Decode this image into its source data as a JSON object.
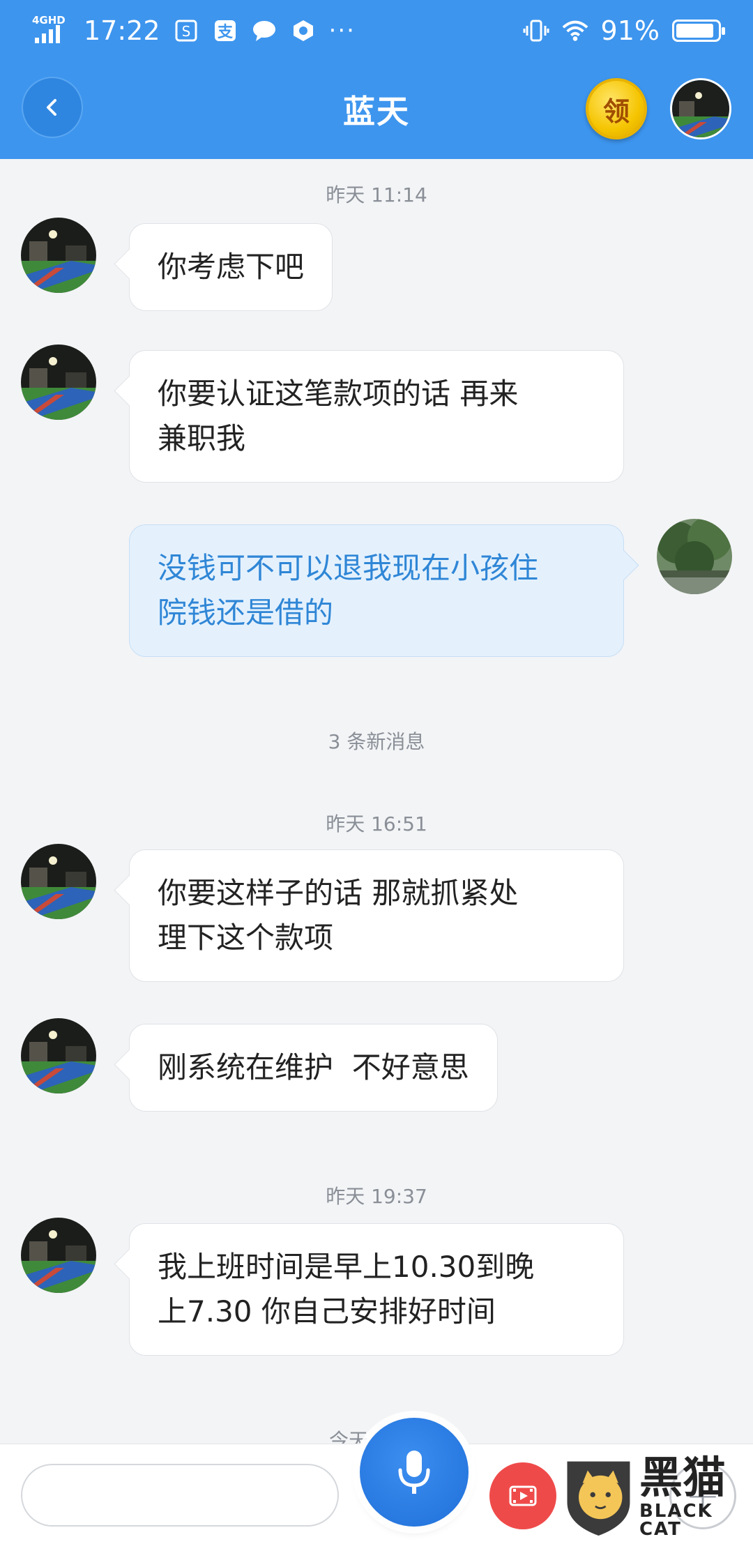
{
  "status_bar": {
    "network": "4GHD",
    "time": "17:22",
    "battery": "91%",
    "battery_level": 0.91
  },
  "header": {
    "title": "蓝天",
    "coin_label": "领"
  },
  "messages": [
    {
      "timestamp": "昨天 11:14"
    },
    {
      "side": "left",
      "lines": [
        "你考虑下吧"
      ]
    },
    {
      "side": "left",
      "lines": [
        "你要认证这笔款项的话 再来",
        "兼职我"
      ]
    },
    {
      "side": "right",
      "lines": [
        "没钱可不可以退我现在小孩住",
        "院钱还是借的"
      ]
    },
    {
      "notice": "3 条新消息"
    },
    {
      "timestamp": "昨天 16:51"
    },
    {
      "side": "left",
      "lines": [
        "你要这样子的话 那就抓紧处",
        "理下这个款项"
      ]
    },
    {
      "side": "left",
      "lines": [
        "刚系统在维护  不好意思"
      ]
    },
    {
      "timestamp": "昨天 19:37"
    },
    {
      "side": "left",
      "lines": [
        "我上班时间是早上10.30到晚",
        "上7.30 你自己安排好时间"
      ]
    },
    {
      "timestamp_partial": "今天"
    }
  ],
  "bottom_bar": {
    "input_placeholder": "",
    "mic_icon": "microphone-icon",
    "video_icon": "video-icon",
    "plus_icon": "plus-icon"
  },
  "watermark": {
    "cn": "黑猫",
    "en": "BLACK CAT"
  },
  "colors": {
    "header": "#3d95ee",
    "right_bubble": "#e4f1fd",
    "right_text": "#2f86d6"
  }
}
